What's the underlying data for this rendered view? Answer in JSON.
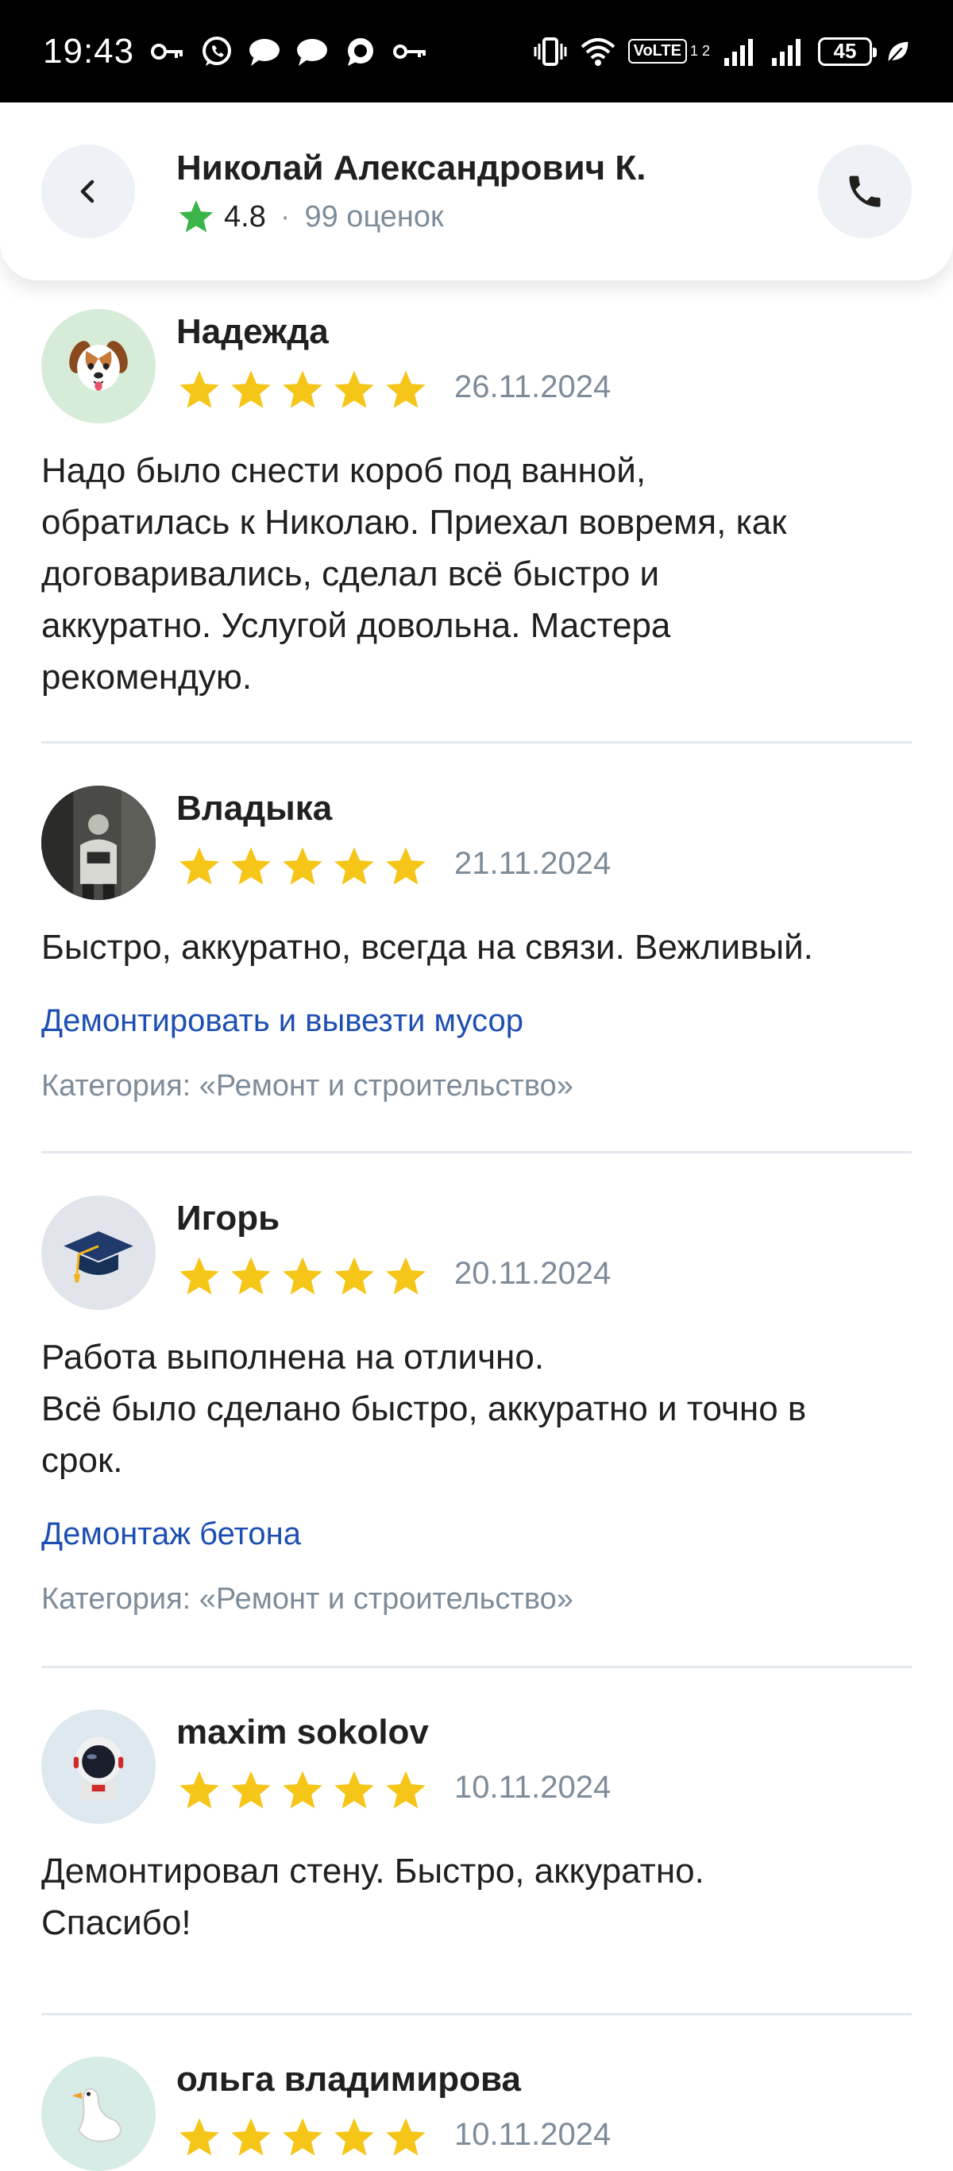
{
  "status_bar": {
    "time": "19:43",
    "volte": "VoLTE",
    "sim_marks": "1 2",
    "battery": "45"
  },
  "header": {
    "title": "Николай Александрович К.",
    "rating": "4.8",
    "separator": "·",
    "ratings_count": "99 оценок"
  },
  "reviews": [
    {
      "name": "Надежда",
      "stars": 5,
      "date": "26.11.2024",
      "text": "Надо было снести короб под ванной,\nобратилась к Николаю. Приехал вовремя, как\nдоговаривались, сделал всё быстро и\nаккуратно. Услугой довольна. Мастера\nрекомендую.",
      "avatar": "dog-avatar"
    },
    {
      "name": "Владыка",
      "stars": 5,
      "date": "21.11.2024",
      "text": "Быстро, аккуратно, всегда на связи. Вежливый.",
      "service": "Демонтировать и вывезти мусор",
      "category": "Категория: «Ремонт и строительство»",
      "avatar": "photo-avatar"
    },
    {
      "name": "Игорь",
      "stars": 5,
      "date": "20.11.2024",
      "text": "Работа выполнена на отлично.\nВсё было сделано быстро, аккуратно и точно в\nсрок.",
      "service": "Демонтаж бетона",
      "category": "Категория: «Ремонт и строительство»",
      "avatar": "graduation-cap-avatar"
    },
    {
      "name": "maxim sokolov",
      "stars": 5,
      "date": "10.11.2024",
      "text": "Демонтировал стену. Быстро, аккуратно.\nСпасибо!",
      "avatar": "astronaut-avatar"
    },
    {
      "name": "ольга владимирова",
      "stars": 5,
      "date": "10.11.2024",
      "avatar": "goose-avatar"
    }
  ],
  "colors": {
    "star": "#f5c518",
    "rating_star": "#3bb54a",
    "link": "#1d4fb2",
    "muted": "#7e8c9a"
  }
}
